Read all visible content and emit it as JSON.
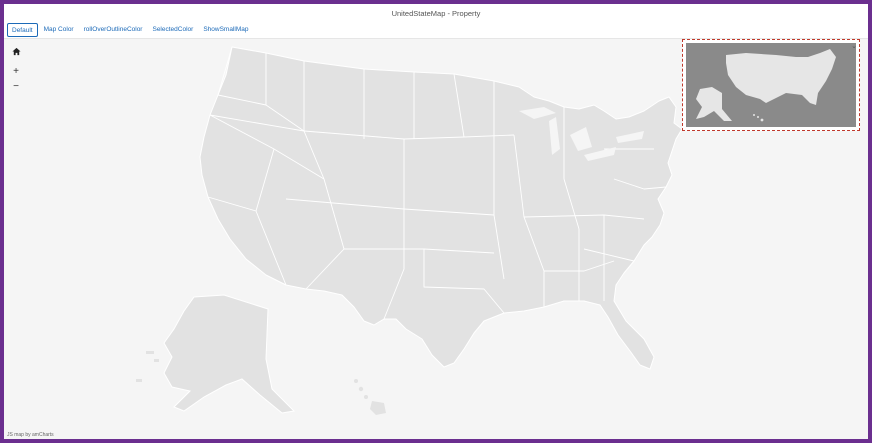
{
  "window": {
    "title": "UnitedStateMap - Property"
  },
  "tabs": [
    {
      "label": "Default"
    },
    {
      "label": "Map Color"
    },
    {
      "label": "rollOverOutlineColor"
    },
    {
      "label": "SelectedColor"
    },
    {
      "label": "ShowSmallMap"
    }
  ],
  "controls": {
    "home_icon": "home-icon",
    "zoom_in": "+",
    "zoom_out": "−"
  },
  "minimap": {
    "collapse": "⌄"
  },
  "credit": {
    "text": "JS map by amCharts"
  },
  "colors": {
    "frame": "#6b2f8f",
    "land": "#e2e2e2",
    "border": "#ffffff",
    "background": "#f5f5f5",
    "minimap_bg": "#8a8a8a",
    "minimap_outline": "#c0392b",
    "tab_text": "#1c6ab8"
  }
}
